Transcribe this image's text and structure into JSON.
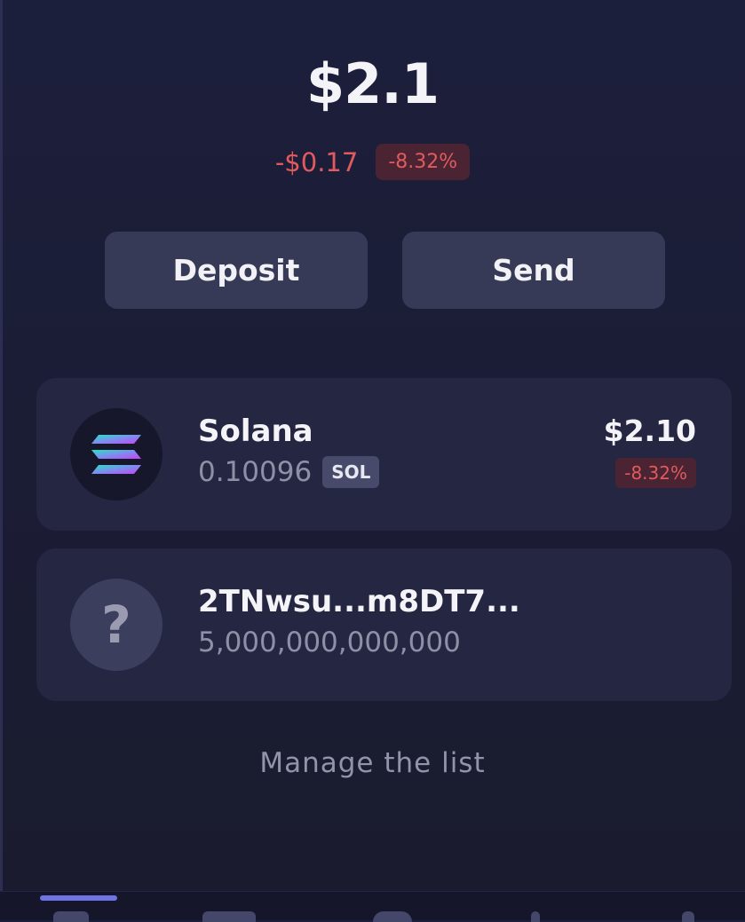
{
  "wallet": {
    "balance": "$2.1",
    "change_amount": "-$0.17",
    "change_percent": "-8.32%"
  },
  "actions": {
    "deposit_label": "Deposit",
    "send_label": "Send"
  },
  "tokens": [
    {
      "name": "Solana",
      "amount": "0.10096",
      "ticker": "SOL",
      "value": "$2.10",
      "change": "-8.32%",
      "icon": "solana-logo-icon"
    },
    {
      "name": "2TNwsu...m8DT7...",
      "amount": "5,000,000,000,000",
      "icon": "question-mark-icon"
    }
  ],
  "manage_label": "Manage the list",
  "colors": {
    "negative": "#e05a5e",
    "negative_badge_bg": "#4a2432",
    "button_bg": "#363a57",
    "card_bg": "#242642",
    "nav_indicator": "#6f73e6"
  }
}
